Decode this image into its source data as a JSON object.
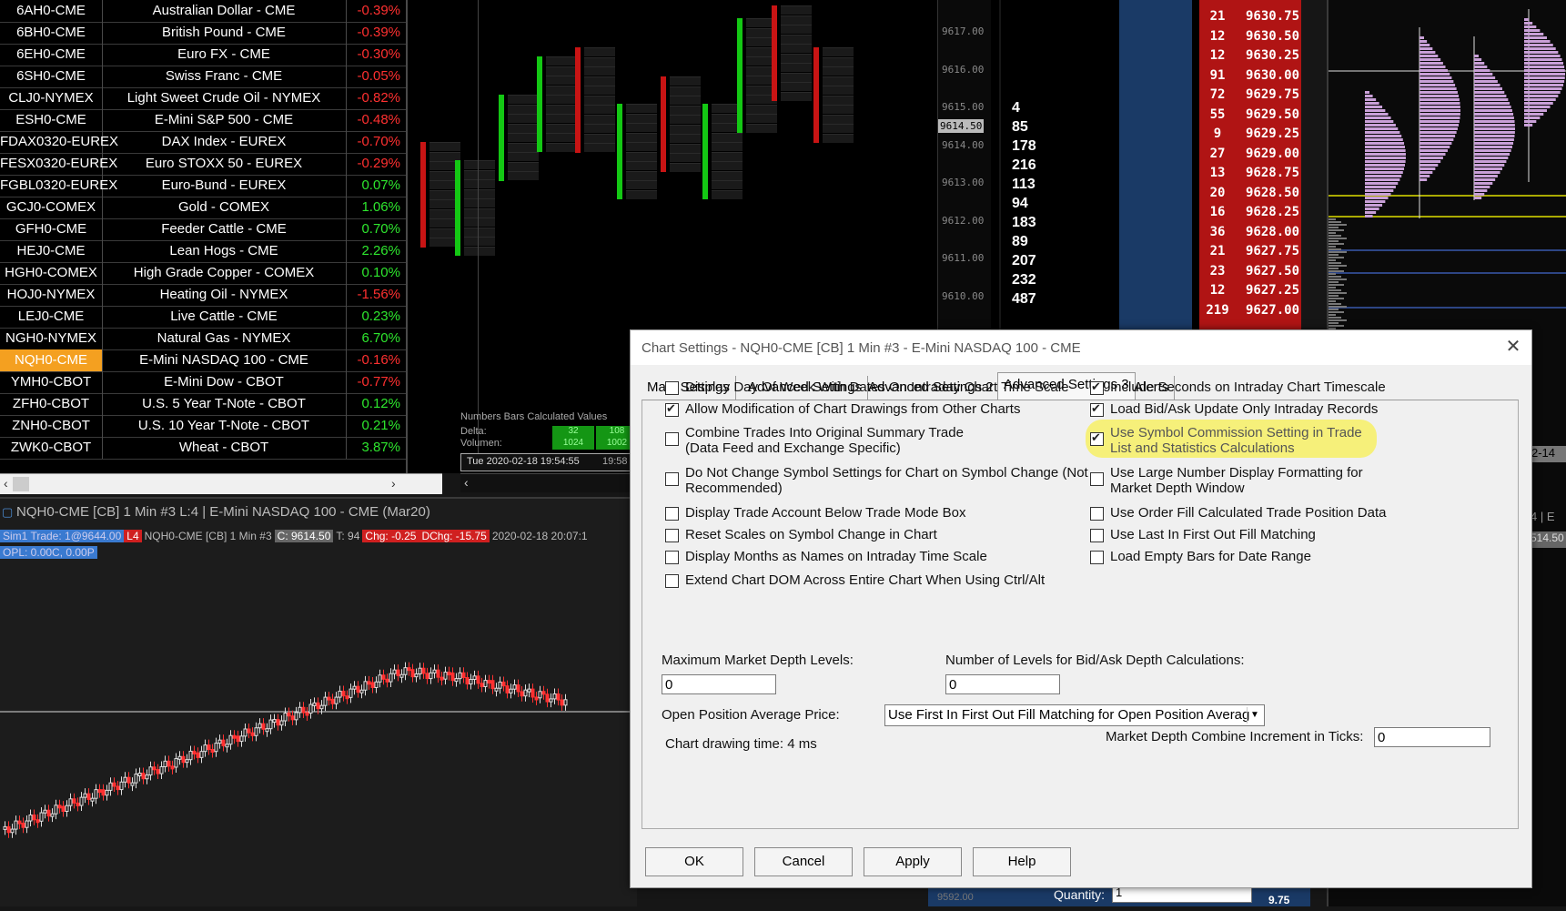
{
  "quote_board": {
    "rows": [
      {
        "symbol": "6AH0-CME",
        "name": "Australian Dollar - CME",
        "change": "-0.39%",
        "dir": "down"
      },
      {
        "symbol": "6BH0-CME",
        "name": "British Pound - CME",
        "change": "-0.39%",
        "dir": "down"
      },
      {
        "symbol": "6EH0-CME",
        "name": "Euro FX - CME",
        "change": "-0.30%",
        "dir": "down"
      },
      {
        "symbol": "6SH0-CME",
        "name": "Swiss Franc - CME",
        "change": "-0.05%",
        "dir": "down"
      },
      {
        "symbol": "CLJ0-NYMEX",
        "name": "Light Sweet Crude Oil - NYMEX",
        "change": "-0.82%",
        "dir": "down"
      },
      {
        "symbol": "ESH0-CME",
        "name": "E-Mini S&P 500 - CME",
        "change": "-0.48%",
        "dir": "down"
      },
      {
        "symbol": "FDAX0320-EUREX",
        "name": "DAX Index - EUREX",
        "change": "-0.70%",
        "dir": "down"
      },
      {
        "symbol": "FESX0320-EUREX",
        "name": "Euro STOXX 50 - EUREX",
        "change": "-0.29%",
        "dir": "down"
      },
      {
        "symbol": "FGBL0320-EUREX",
        "name": "Euro-Bund - EUREX",
        "change": "0.07%",
        "dir": "up"
      },
      {
        "symbol": "GCJ0-COMEX",
        "name": "Gold - COMEX",
        "change": "1.06%",
        "dir": "up"
      },
      {
        "symbol": "GFH0-CME",
        "name": "Feeder Cattle - CME",
        "change": "0.70%",
        "dir": "up"
      },
      {
        "symbol": "HEJ0-CME",
        "name": "Lean Hogs - CME",
        "change": "2.26%",
        "dir": "up"
      },
      {
        "symbol": "HGH0-COMEX",
        "name": "High Grade Copper - COMEX",
        "change": "0.10%",
        "dir": "up"
      },
      {
        "symbol": "HOJ0-NYMEX",
        "name": "Heating Oil - NYMEX",
        "change": "-1.56%",
        "dir": "down"
      },
      {
        "symbol": "LEJ0-CME",
        "name": "Live Cattle - CME",
        "change": "0.23%",
        "dir": "up"
      },
      {
        "symbol": "NGH0-NYMEX",
        "name": "Natural Gas - NYMEX",
        "change": "6.70%",
        "dir": "up"
      },
      {
        "symbol": "NQH0-CME",
        "name": "E-Mini NASDAQ 100 - CME",
        "change": "-0.16%",
        "dir": "down",
        "selected": true
      },
      {
        "symbol": "YMH0-CBOT",
        "name": "E-Mini Dow - CBOT",
        "change": "-0.77%",
        "dir": "down"
      },
      {
        "symbol": "ZFH0-CBOT",
        "name": "U.S. 5 Year T-Note - CBOT",
        "change": "0.12%",
        "dir": "up"
      },
      {
        "symbol": "ZNH0-CBOT",
        "name": "U.S. 10 Year T-Note - CBOT",
        "change": "0.21%",
        "dir": "up"
      },
      {
        "symbol": "ZWK0-CBOT",
        "name": "Wheat - CBOT",
        "change": "3.87%",
        "dir": "up"
      }
    ],
    "scroll_left": "‹",
    "scroll_right": "›"
  },
  "numbers_chart": {
    "axis_labels": [
      "9617.00",
      "9616.00",
      "9615.00",
      "9614.00",
      "9613.00",
      "9612.00",
      "9611.00",
      "9610.00"
    ],
    "price_tag": "9614.50",
    "study_label": "Numbers Bars Calculated Values",
    "delta_label": "Delta:",
    "volume_label": "Volumen:",
    "delta_values": [
      "32",
      "108"
    ],
    "volume_values": [
      "1024",
      "1002"
    ],
    "time_label": "Tue 2020-02-18  19:54:55",
    "time_right": "19:58"
  },
  "dom": {
    "left_volumes": [
      "4",
      "85",
      "178",
      "216",
      "113",
      "94",
      "183",
      "89",
      "207",
      "232",
      "487"
    ],
    "ladder": [
      {
        "n": "21",
        "p": "9630.75"
      },
      {
        "n": "12",
        "p": "9630.50"
      },
      {
        "n": "12",
        "p": "9630.25"
      },
      {
        "n": "91",
        "p": "9630.00"
      },
      {
        "n": "72",
        "p": "9629.75"
      },
      {
        "n": "55",
        "p": "9629.50"
      },
      {
        "n": "9",
        "p": "9629.25"
      },
      {
        "n": "27",
        "p": "9629.00"
      },
      {
        "n": "13",
        "p": "9628.75"
      },
      {
        "n": "20",
        "p": "9628.50"
      },
      {
        "n": "16",
        "p": "9628.25"
      },
      {
        "n": "36",
        "p": "9628.00"
      },
      {
        "n": "21",
        "p": "9627.75"
      },
      {
        "n": "23",
        "p": "9627.50"
      },
      {
        "n": "12",
        "p": "9627.25"
      },
      {
        "n": "219",
        "p": "9627.00"
      }
    ],
    "quantity_label": "Quantity:",
    "quantity_value": "1",
    "bottom_price": "9.75"
  },
  "right_chart": {
    "tag1": "2-14",
    "tag2": "4 | E",
    "tag3": "514.50"
  },
  "bottom_chart": {
    "title": "NQH0-CME [CB]  1 Min  #3  L:4 | E-Mini NASDAQ 100 - CME (Mar20)",
    "info": {
      "sim": "Sim1  Trade: 1@9644.00",
      "l4": "L4",
      "sym": "NQH0-CME [CB]  1 Min  #3",
      "c": "C: 9614.50",
      "t": "T: 94",
      "chg": "Chg: -0.25",
      "dchg": "DChg: -15.75",
      "date": "2020-02-18 20:07:1",
      "opl": "OPL: 0.00C, 0.00P"
    },
    "axis_bottom": "9592.00"
  },
  "dialog": {
    "title": "Chart Settings - NQH0-CME [CB]  1 Min  #3 - E-Mini NASDAQ 100 - CME",
    "close": "✕",
    "tabs": [
      "Main Settings",
      "Advanced Settings",
      "Advanced Settings 2",
      "Advanced Settings 3",
      "Alerts"
    ],
    "active_tab": 3,
    "left_options": [
      {
        "label": "Display Day Of Week With Dates On Intraday Chart Time Scale",
        "checked": false
      },
      {
        "label": "Allow Modification of Chart Drawings from Other Charts",
        "checked": true
      },
      {
        "label": "Combine Trades Into Original Summary Trade",
        "label2": "(Data Feed and Exchange Specific)",
        "checked": false
      },
      {
        "label": "Do Not Change Symbol Settings for Chart on Symbol Change (Not",
        "label2": "Recommended)",
        "checked": false
      },
      {
        "label": "Display Trade Account Below Trade Mode Box",
        "checked": false
      },
      {
        "label": "Reset Scales on Symbol Change in Chart",
        "checked": false
      },
      {
        "label": "Display Months as Names on Intraday Time Scale",
        "checked": false
      },
      {
        "label": "Extend Chart DOM Across Entire Chart When Using Ctrl/Alt",
        "checked": false
      }
    ],
    "right_options": [
      {
        "label": "Include Seconds on Intraday Chart Timescale",
        "checked": true
      },
      {
        "label": "Load Bid/Ask Update Only Intraday Records",
        "checked": true
      },
      {
        "label": "Use Symbol Commission Setting in Trade",
        "label2": "List and Statistics Calculations",
        "checked": true,
        "highlighted": true
      },
      {
        "label": "Use Large Number Display Formatting for",
        "label2": "Market Depth Window",
        "checked": false
      },
      {
        "label": "Use Order Fill Calculated Trade Position Data",
        "checked": false
      },
      {
        "label": "Use Last In First Out Fill Matching",
        "checked": false
      },
      {
        "label": "Load Empty Bars for Date Range",
        "checked": false
      }
    ],
    "max_depth_label": "Maximum Market Depth Levels:",
    "max_depth_value": "0",
    "bidask_levels_label": "Number of Levels for Bid/Ask Depth Calculations:",
    "bidask_levels_value": "0",
    "open_pos_label": "Open Position Average Price:",
    "open_pos_value": "Use First In First Out Fill Matching for Open Position Averag",
    "combine_incr_label": "Market Depth Combine Increment in Ticks:",
    "combine_incr_value": "0",
    "drawing_time": "Chart drawing time: 4 ms",
    "buttons": {
      "ok": "OK",
      "cancel": "Cancel",
      "apply": "Apply",
      "help": "Help"
    }
  },
  "colors": {
    "up": "#2ee62e",
    "down": "#ff3030",
    "selected": "#f4a020",
    "highlight": "#f6f07a"
  }
}
